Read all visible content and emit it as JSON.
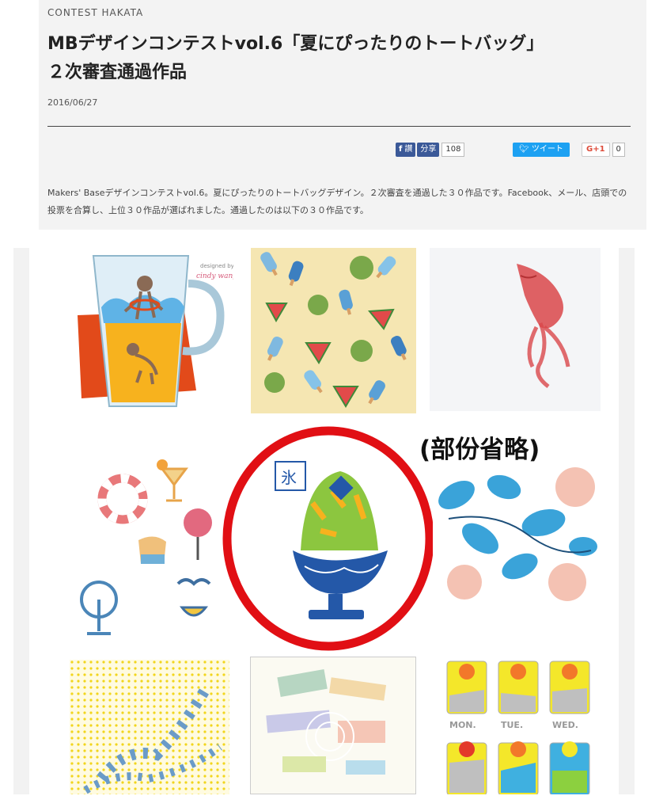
{
  "article": {
    "category": "CONTEST HAKATA",
    "title_line1": "MBデザインコンテストvol.6「夏にぴったりのトートバッグ」",
    "title_line2": "２次審査通過作品",
    "date": "2016/06/27",
    "intro": "Makers' Baseデザインコンテストvol.6。夏にぴったりのトートバッグデザイン。２次審査を通過した３０作品です。Facebook、メール、店頭での投票を合算し、上位３０作品が選ばれました。通過したのは以下の３０作品です。"
  },
  "share": {
    "facebook_like": "いいね",
    "facebook_like_glyph": "讃",
    "facebook_share": "分享",
    "facebook_count": "108",
    "tweet": "ツイート",
    "gplus": "G+1",
    "gplus_count": "0"
  },
  "gallery": {
    "omitted_note": "(部份省略)",
    "artworks": [
      {
        "id": "beer-mug",
        "signature": "designed by cindy wang"
      },
      {
        "id": "watermelon-popsicle"
      },
      {
        "id": "goldfish"
      },
      {
        "id": "summer-items"
      },
      {
        "id": "shaved-ice",
        "label": "氷"
      },
      {
        "id": "blue-flowers"
      },
      {
        "id": "yellow-dots-fish"
      },
      {
        "id": "pastel-abstract"
      },
      {
        "id": "weekdays",
        "days": [
          "MON.",
          "TUE.",
          "WED."
        ]
      }
    ]
  },
  "colors": {
    "header_bg": "#f3f3f3",
    "facebook": "#3b5998",
    "twitter": "#1da1f2",
    "gplus": "#dd4b39",
    "highlight_circle": "#e10f14"
  }
}
